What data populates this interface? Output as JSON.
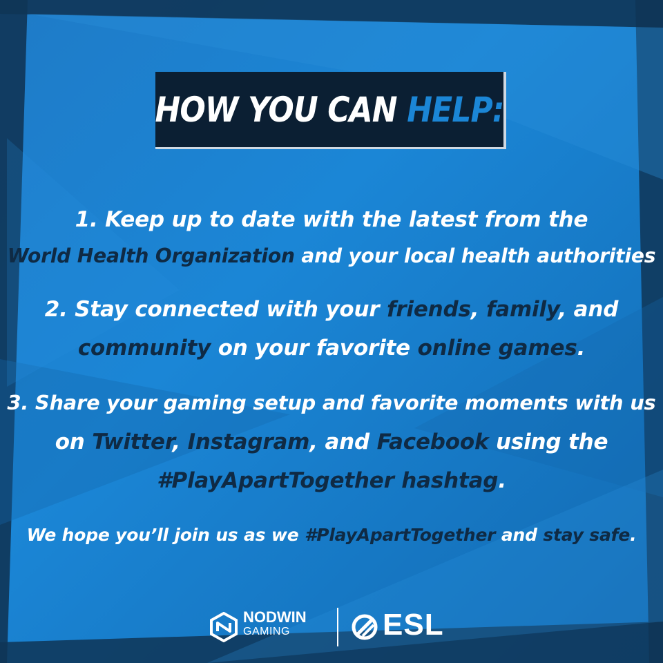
{
  "title": {
    "part1": "HOW YOU CAN ",
    "part2": "HELP:"
  },
  "colors": {
    "background": "#1b86d6",
    "highlight": "#0f2a44",
    "title_box": "#0b1f33",
    "text": "#ffffff"
  },
  "item1": {
    "line1": "1. Keep up to date with the latest from the",
    "line2_hl": "World Health Organization",
    "line2_rest": " and your local health authorities"
  },
  "item2": {
    "l1_a": "2. Stay connected with your ",
    "l1_b": "friends",
    "l1_c": ", ",
    "l1_d": "family",
    "l1_e": ", and",
    "l2_a": "community",
    "l2_b": " on your favorite ",
    "l2_c": "online games",
    "l2_d": "."
  },
  "item3": {
    "line1": "3. Share your gaming setup and favorite moments with us",
    "l2_a": "on ",
    "l2_b": "Twitter",
    "l2_c": ", ",
    "l2_d": "Instagram",
    "l2_e": ", and ",
    "l2_f": "Facebook",
    "l2_g": " using the",
    "l3_a": "#PlayApartTogether hashtag",
    "l3_b": "."
  },
  "closing": {
    "a": "We hope you’ll join us as we ",
    "b": "#PlayApartTogether",
    "c": " and ",
    "d": "stay safe",
    "e": "."
  },
  "logos": {
    "nodwin_name": "NODWIN",
    "nodwin_sub": "GAMING",
    "nodwin_icon": "nodwin-logo-icon",
    "esl_text": "ESL",
    "esl_icon": "esl-logo-icon"
  }
}
